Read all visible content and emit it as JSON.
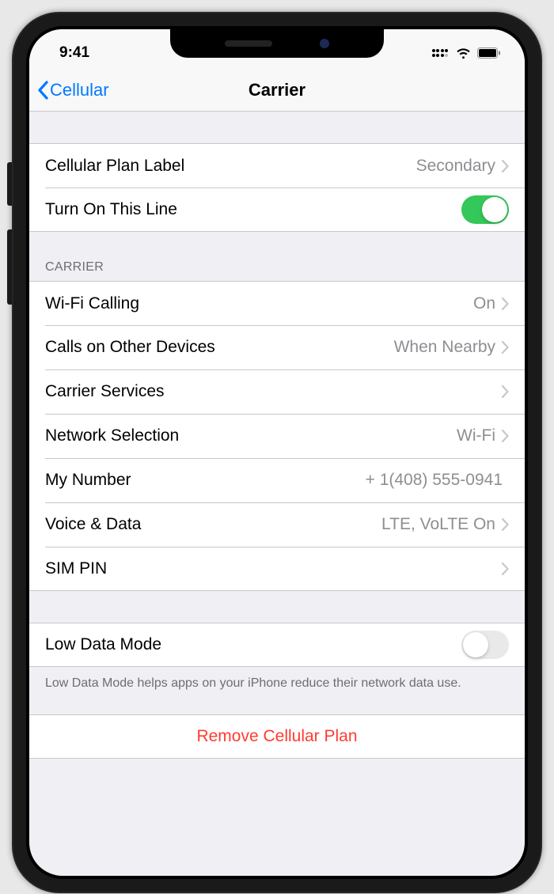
{
  "status": {
    "time": "9:41"
  },
  "nav": {
    "back": "Cellular",
    "title": "Carrier"
  },
  "section1": {
    "planLabel": {
      "title": "Cellular Plan Label",
      "value": "Secondary"
    },
    "turnOn": {
      "title": "Turn On This Line",
      "on": true
    }
  },
  "carrierHeader": "Carrier",
  "carrier": {
    "wifiCalling": {
      "title": "Wi-Fi Calling",
      "value": "On"
    },
    "callsOther": {
      "title": "Calls on Other Devices",
      "value": "When Nearby"
    },
    "services": {
      "title": "Carrier Services",
      "value": ""
    },
    "network": {
      "title": "Network Selection",
      "value": "Wi-Fi"
    },
    "myNumber": {
      "title": "My Number",
      "value": "+ 1(408) 555-0941"
    },
    "voiceData": {
      "title": "Voice & Data",
      "value": "LTE, VoLTE On"
    },
    "simPin": {
      "title": "SIM PIN",
      "value": ""
    }
  },
  "lowData": {
    "title": "Low Data Mode",
    "on": false,
    "footer": "Low Data Mode helps apps on your iPhone reduce their network data use."
  },
  "remove": "Remove Cellular Plan"
}
